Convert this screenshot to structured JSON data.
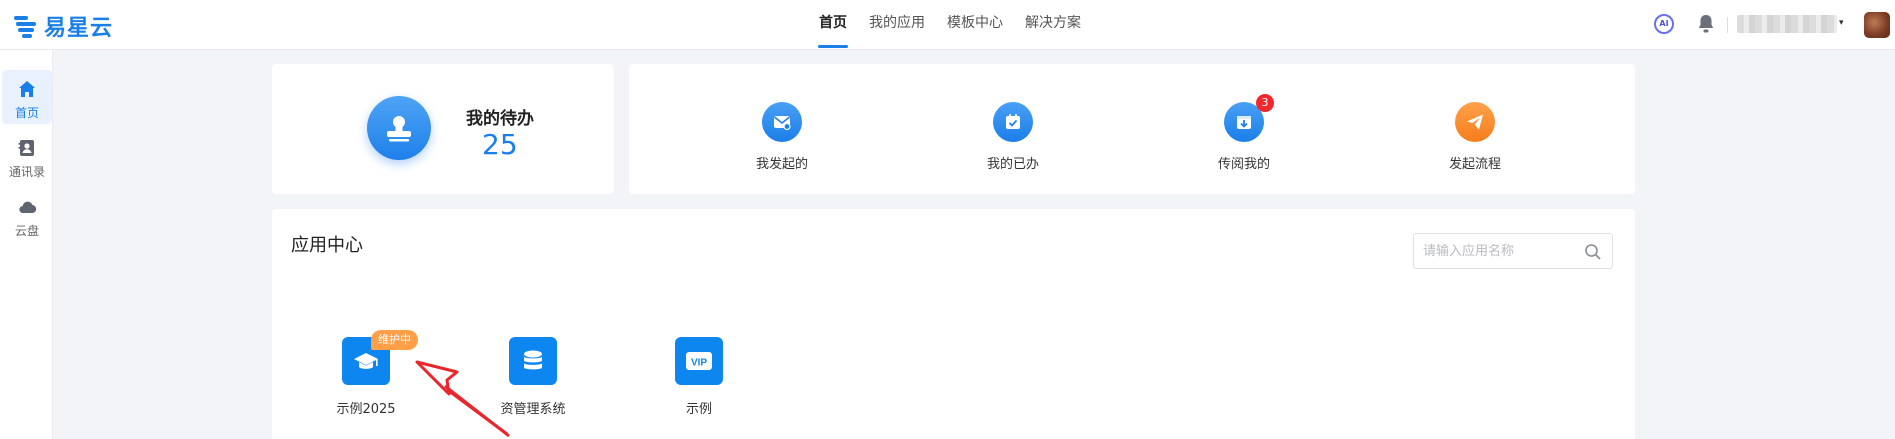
{
  "header": {
    "logo_text": "易星云",
    "nav": [
      {
        "label": "首页",
        "active": true
      },
      {
        "label": "我的应用",
        "active": false
      },
      {
        "label": "模板中心",
        "active": false
      },
      {
        "label": "解决方案",
        "active": false
      }
    ],
    "ai_label": "AI",
    "icons": [
      "ai-icon",
      "bell-icon",
      "avatar"
    ],
    "accent_color": "#1a7fe8"
  },
  "sidebar": {
    "items": [
      {
        "label": "首页",
        "icon": "home-icon",
        "active": true
      },
      {
        "label": "通讯录",
        "icon": "contacts-icon",
        "active": false
      },
      {
        "label": "云盘",
        "icon": "cloud-icon",
        "active": false
      }
    ]
  },
  "todo": {
    "title": "我的待办",
    "count": "25",
    "icon": "user-stamp-icon"
  },
  "actions": [
    {
      "label": "我发起的",
      "icon": "mail-icon"
    },
    {
      "label": "我的已办",
      "icon": "calendar-check-icon"
    },
    {
      "label": "传阅我的",
      "icon": "inbox-download-icon",
      "badge": "3"
    },
    {
      "label": "发起流程",
      "icon": "paper-plane-icon"
    }
  ],
  "apps_section": {
    "title": "应用中心",
    "search_placeholder": "请输入应用名称",
    "apps": [
      {
        "name": "示例2025",
        "icon": "graduation-cap-icon",
        "badge": "维护中"
      },
      {
        "name": "资管理系统",
        "icon": "database-icon"
      },
      {
        "name": "示例",
        "icon": "vip-icon",
        "icon_text": "VIP"
      }
    ]
  }
}
